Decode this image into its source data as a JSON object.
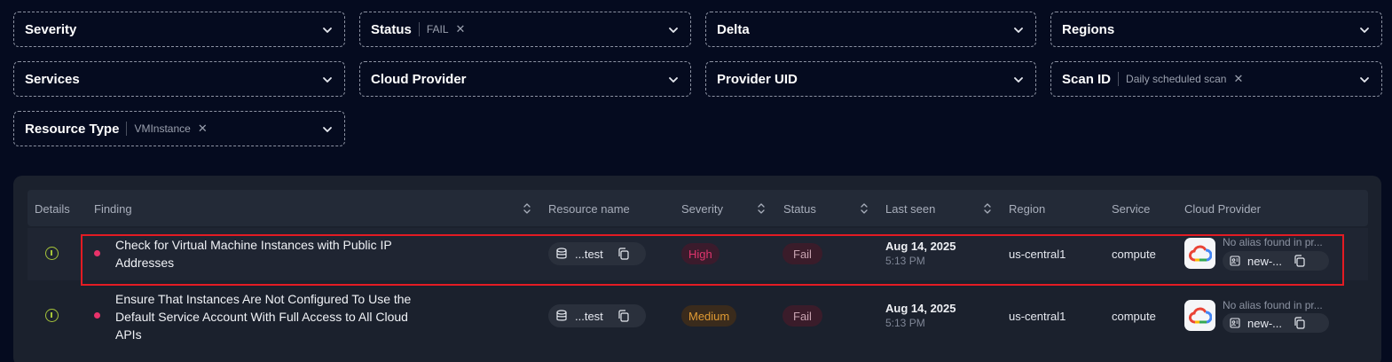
{
  "filters": [
    {
      "label": "Severity"
    },
    {
      "label": "Status",
      "value": "FAIL"
    },
    {
      "label": "Delta"
    },
    {
      "label": "Regions"
    },
    {
      "label": "Services"
    },
    {
      "label": "Cloud Provider"
    },
    {
      "label": "Provider UID"
    },
    {
      "label": "Scan ID",
      "value": "Daily scheduled scan"
    },
    {
      "label": "Resource Type",
      "value": "VMInstance"
    }
  ],
  "table": {
    "columns": [
      "Details",
      "Finding",
      "Resource name",
      "Severity",
      "Status",
      "Last seen",
      "Region",
      "Service",
      "Cloud Provider"
    ],
    "rows": [
      {
        "finding_line1": "Check for Virtual Machine Instances with Public IP",
        "finding_line2": "Addresses",
        "finding_line3": "",
        "resource": "...test",
        "severity": "High",
        "status": "Fail",
        "date": "Aug 14, 2025",
        "time": "5:13 PM",
        "region": "us-central1",
        "service": "compute",
        "alias": "No alias found in pr...",
        "uid": "new-..."
      },
      {
        "finding_line1": "Ensure That Instances Are Not Configured To Use the",
        "finding_line2": "Default Service Account With Full Access to All Cloud",
        "finding_line3": "APIs",
        "resource": "...test",
        "severity": "Medium",
        "status": "Fail",
        "date": "Aug 14, 2025",
        "time": "5:13 PM",
        "region": "us-central1",
        "service": "compute",
        "alias": "No alias found in pr...",
        "uid": "new-..."
      }
    ]
  },
  "colors": {
    "background": "#050b1f",
    "panel": "#1b212d",
    "severity_high": "#e0356d",
    "severity_medium": "#e09a33",
    "highlight": "#e31b23",
    "info_icon": "#a6c43a"
  },
  "icons": [
    "chevron-down-icon",
    "close-icon",
    "sort-icon",
    "info-icon",
    "database-icon",
    "copy-icon",
    "google-cloud-icon",
    "id-card-icon"
  ]
}
